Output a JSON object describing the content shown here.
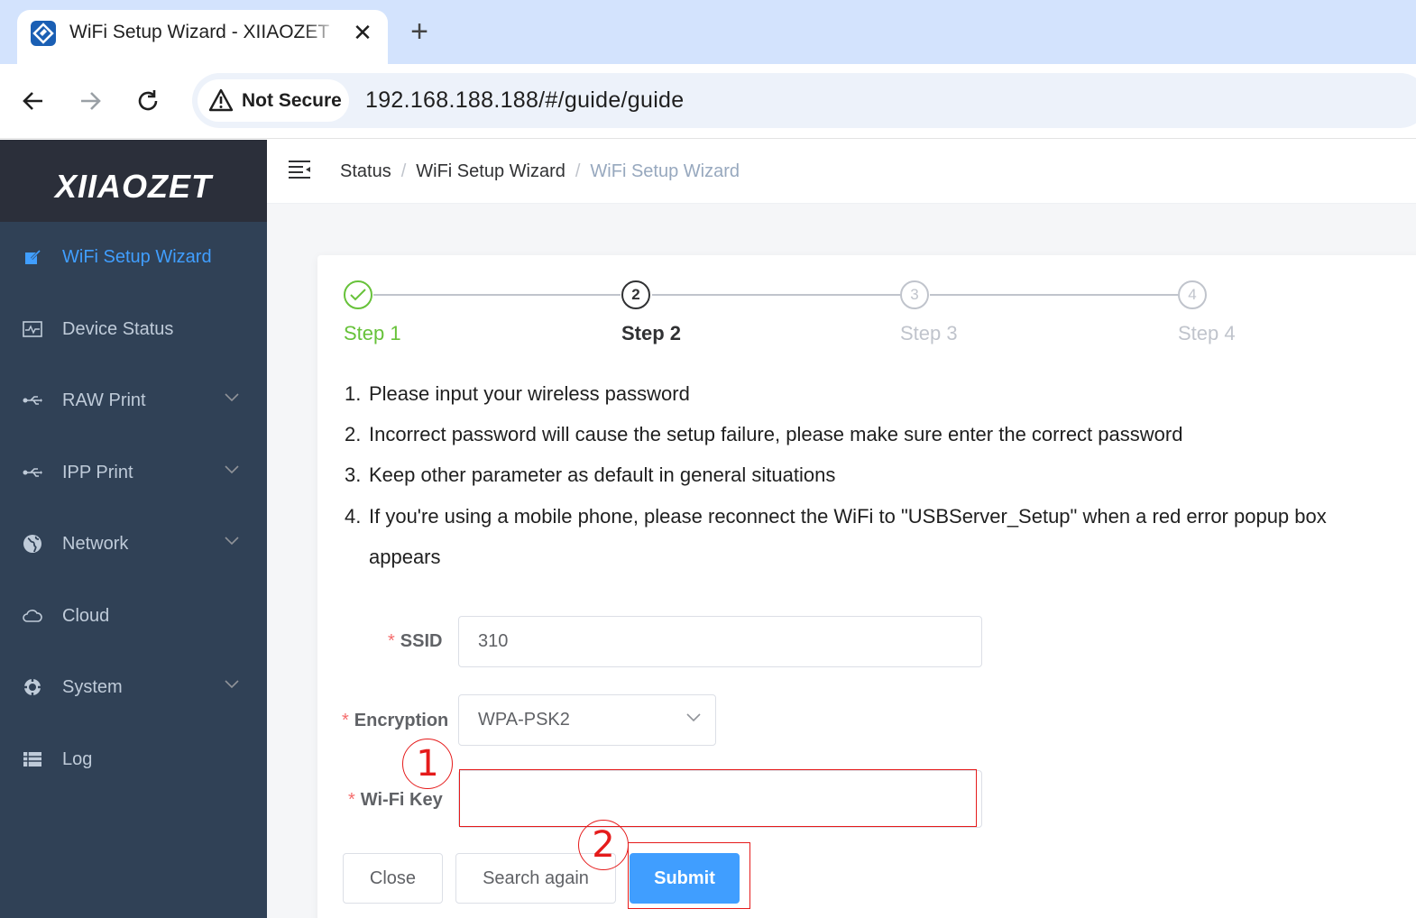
{
  "browser": {
    "tab_title": "WiFi Setup Wizard - XIIAOZET",
    "tab_close": "✕",
    "new_tab": "+",
    "security_label": "Not Secure",
    "url": "192.168.188.188/#/guide/guide"
  },
  "sidebar": {
    "logo": "XIIAOZET",
    "items": [
      {
        "label": "WiFi Setup Wizard",
        "icon": "edit-icon",
        "active": true
      },
      {
        "label": "Device Status",
        "icon": "monitor-icon"
      },
      {
        "label": "RAW Print",
        "icon": "usb-icon",
        "expandable": true
      },
      {
        "label": "IPP Print",
        "icon": "usb-icon",
        "expandable": true
      },
      {
        "label": "Network",
        "icon": "globe-icon",
        "expandable": true
      },
      {
        "label": "Cloud",
        "icon": "cloud-icon"
      },
      {
        "label": "System",
        "icon": "gear-icon",
        "expandable": true
      },
      {
        "label": "Log",
        "icon": "list-icon"
      }
    ]
  },
  "breadcrumb": {
    "items": [
      "Status",
      "WiFi Setup Wizard",
      "WiFi Setup Wizard"
    ],
    "separator": "/"
  },
  "steps": {
    "items": [
      {
        "title": "Step 1",
        "number": "1",
        "state": "done"
      },
      {
        "title": "Step 2",
        "number": "2",
        "state": "current"
      },
      {
        "title": "Step 3",
        "number": "3",
        "state": "wait"
      },
      {
        "title": "Step 4",
        "number": "4",
        "state": "wait"
      }
    ]
  },
  "instructions": [
    {
      "num": "1.",
      "text": "Please input your wireless password"
    },
    {
      "num": "2.",
      "text": "Incorrect password will cause the setup failure, please make sure enter the correct password"
    },
    {
      "num": "3.",
      "text": "Keep other parameter as default in general situations"
    },
    {
      "num": "4.",
      "text": "If you're using a mobile phone, please reconnect the WiFi to \"USBServer_Setup\" when a red error popup box",
      "continuation": "appears"
    }
  ],
  "form": {
    "required_mark": "*",
    "ssid_label": "SSID",
    "ssid_value": "310",
    "encryption_label": "Encryption",
    "encryption_value": "WPA-PSK2",
    "wifikey_label": "Wi-Fi Key",
    "wifikey_value": ""
  },
  "buttons": {
    "close": "Close",
    "search_again": "Search again",
    "submit": "Submit"
  },
  "annotations": {
    "marker_1": "1",
    "marker_2": "2"
  },
  "colors": {
    "sidebar_bg": "#304156",
    "logo_bg": "#2b2f3a",
    "active_menu": "#409eff",
    "step_done": "#67c23a",
    "primary": "#409eff",
    "annotation": "#e51b1b"
  }
}
